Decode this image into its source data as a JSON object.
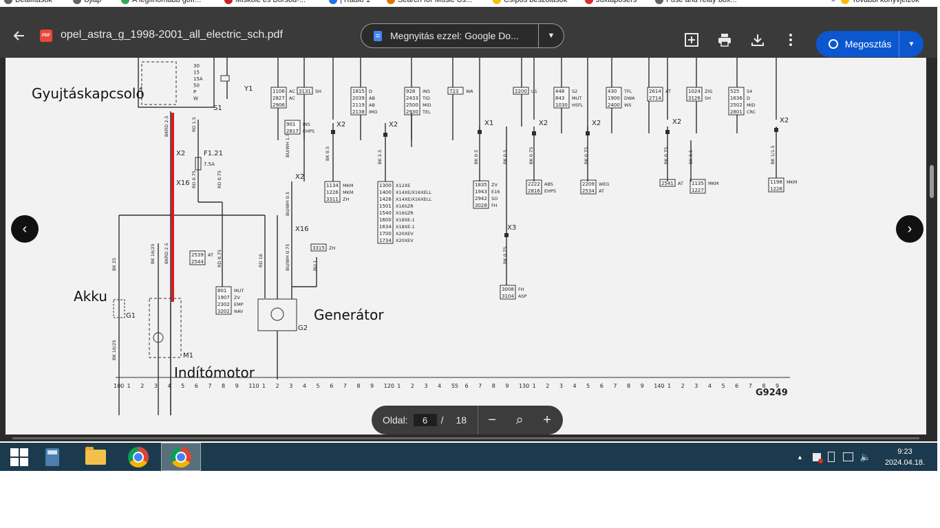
{
  "bookmarks": [
    {
      "label": "Beállítások",
      "color": "#5f6368"
    },
    {
      "label": "Újlap",
      "color": "#5f6368"
    },
    {
      "label": "A legfinomabb gofr...",
      "color": "#34a853"
    },
    {
      "label": "Miskolc és Borsod-...",
      "color": "#c5221f"
    },
    {
      "label": "| Rádió 1",
      "color": "#1a73e8"
    },
    {
      "label": "Search for Music Us...",
      "color": "#e37400"
    },
    {
      "label": "Csípős beszólások",
      "color": "#fbbc04"
    },
    {
      "label": "Juxtaposers",
      "color": "#d93025"
    },
    {
      "label": "Fuse and relay box...",
      "color": "#5f6368"
    },
    {
      "label": "»",
      "color": "#ffffff"
    },
    {
      "label": "További könyvjelzők",
      "color": "#fbbc04"
    }
  ],
  "toolbar": {
    "file_name": "opel_astra_g_1998-2001_all_electric_sch.pdf",
    "pdf_badge": "PDF",
    "open_with_label": "Megnyitás ezzel: Google Do...",
    "share_label": "Megosztás"
  },
  "icons": {
    "back": "arrow-left-icon",
    "add_note": "add-comment-icon",
    "print": "printer-icon",
    "download": "download-icon",
    "more": "more-vert-icon",
    "share": "globe-icon"
  },
  "page_ctrl": {
    "label": "Oldal:",
    "current": "6",
    "slash": "/",
    "total": "18",
    "zoom_out": "−",
    "zoom_fit": "⌕",
    "zoom_in": "+"
  },
  "annotations": {
    "ignition": "Gyujtáskapcsoló",
    "battery": "Akku",
    "generator": "Generátor",
    "starter": "Indítómotor"
  },
  "schematic": {
    "drawing_code": "G9249",
    "comp_labels": [
      "S1",
      "Y1",
      "F1.21",
      "7.5A",
      "G1",
      "M1",
      "G2",
      "X2",
      "X16",
      "X1",
      "X3"
    ],
    "ignition_terms": [
      "30",
      "15",
      "15A",
      "50",
      "P",
      "W"
    ],
    "ruler": [
      "100",
      "1",
      "2",
      "3",
      "4",
      "5",
      "6",
      "7",
      "8",
      "9",
      "110",
      "1",
      "2",
      "3",
      "4",
      "5",
      "6",
      "7",
      "8",
      "9",
      "120",
      "1",
      "2",
      "3",
      "4",
      "55",
      "6",
      "7",
      "8",
      "9",
      "130",
      "1",
      "2",
      "3",
      "4",
      "5",
      "6",
      "7",
      "8",
      "9",
      "140",
      "1",
      "2",
      "3",
      "4",
      "5",
      "6",
      "7",
      "8",
      "9"
    ],
    "boxes": [
      {
        "codes": [
          "1106",
          "2827",
          "2906"
        ],
        "notes": [
          "AC",
          "AC"
        ]
      },
      {
        "codes": [
          "3131"
        ],
        "notes": [
          "SH"
        ]
      },
      {
        "codes": [
          "1815",
          "2039",
          "2119",
          "2138"
        ],
        "notes": [
          "D",
          "AB",
          "AB",
          "IMO"
        ]
      },
      {
        "codes": [
          "928",
          "2433",
          "2500",
          "2930"
        ],
        "notes": [
          "INS",
          "TID",
          "MID",
          "TEL"
        ]
      },
      {
        "codes": [
          "723"
        ],
        "notes": [
          "WA"
        ]
      },
      {
        "codes": [
          "2200"
        ],
        "notes": [
          "U1"
        ]
      },
      {
        "codes": [
          "448",
          "843",
          "1030"
        ],
        "notes": [
          "S2",
          "MUT",
          "HSFL"
        ]
      },
      {
        "codes": [
          "430",
          "1900",
          "2400"
        ],
        "notes": [
          "TFL",
          "DWA",
          "WS"
        ]
      },
      {
        "codes": [
          "2614",
          "2714"
        ],
        "notes": [
          "AT"
        ]
      },
      {
        "codes": [
          "1024",
          "3126"
        ],
        "notes": [
          "ZIG",
          "SH"
        ]
      },
      {
        "codes": [
          "525",
          "1636",
          "2502",
          "2801"
        ],
        "notes": [
          "S4",
          "D",
          "MID",
          "CRC"
        ]
      },
      {
        "codes": [
          "901",
          "2817"
        ],
        "notes": [
          "INS",
          "EHPS"
        ]
      },
      {
        "codes": [
          "1134",
          "1226",
          "3311"
        ],
        "notes": [
          "MKM",
          "MKM",
          "ZH"
        ]
      },
      {
        "codes": [
          "1300",
          "1400",
          "1426",
          "1501",
          "1540",
          "1600",
          "1634",
          "1700",
          "1734"
        ],
        "notes": [
          "X12XE",
          "X14XE/X16XELL",
          "X14XE/X16XELL",
          "X16SZR",
          "X16SZR",
          "X18XE-1",
          "X18XE-1",
          "X20XEV",
          "X20XEV"
        ]
      },
      {
        "codes": [
          "1835",
          "1943",
          "2942",
          "3028"
        ],
        "notes": [
          "ZV",
          "E16",
          "SO",
          "FH"
        ]
      },
      {
        "codes": [
          "2222",
          "2816"
        ],
        "notes": [
          "ABS",
          "EHPS"
        ]
      },
      {
        "codes": [
          "2209",
          "2534"
        ],
        "notes": [
          "WEG",
          "AT"
        ]
      },
      {
        "codes": [
          "2541"
        ],
        "notes": [
          "AT"
        ]
      },
      {
        "codes": [
          "1135",
          "1227"
        ],
        "notes": [
          "MKM"
        ]
      },
      {
        "codes": [
          "1198",
          "1228"
        ],
        "notes": [
          "MKM"
        ]
      },
      {
        "codes": [
          "2539",
          "2544"
        ],
        "notes": [
          "AT"
        ]
      },
      {
        "codes": [
          "801",
          "1907",
          "2302",
          "3202"
        ],
        "notes": [
          "MUT",
          "ZV",
          "EMP",
          "NAV"
        ]
      },
      {
        "codes": [
          "3315"
        ],
        "notes": [
          "ZH"
        ]
      },
      {
        "codes": [
          "3008",
          "3104"
        ],
        "notes": [
          "FH",
          "ASP"
        ]
      }
    ]
  },
  "taskbar": {
    "time": "9:23",
    "date": "2024.04.18."
  },
  "colors": {
    "toolbar_bg": "#3a3a3a",
    "share_bg": "#0b57d0",
    "taskbar_bg": "#1c3a4d",
    "highlight_wire": "#e0191c",
    "page_bg": "#f2f2f2"
  }
}
